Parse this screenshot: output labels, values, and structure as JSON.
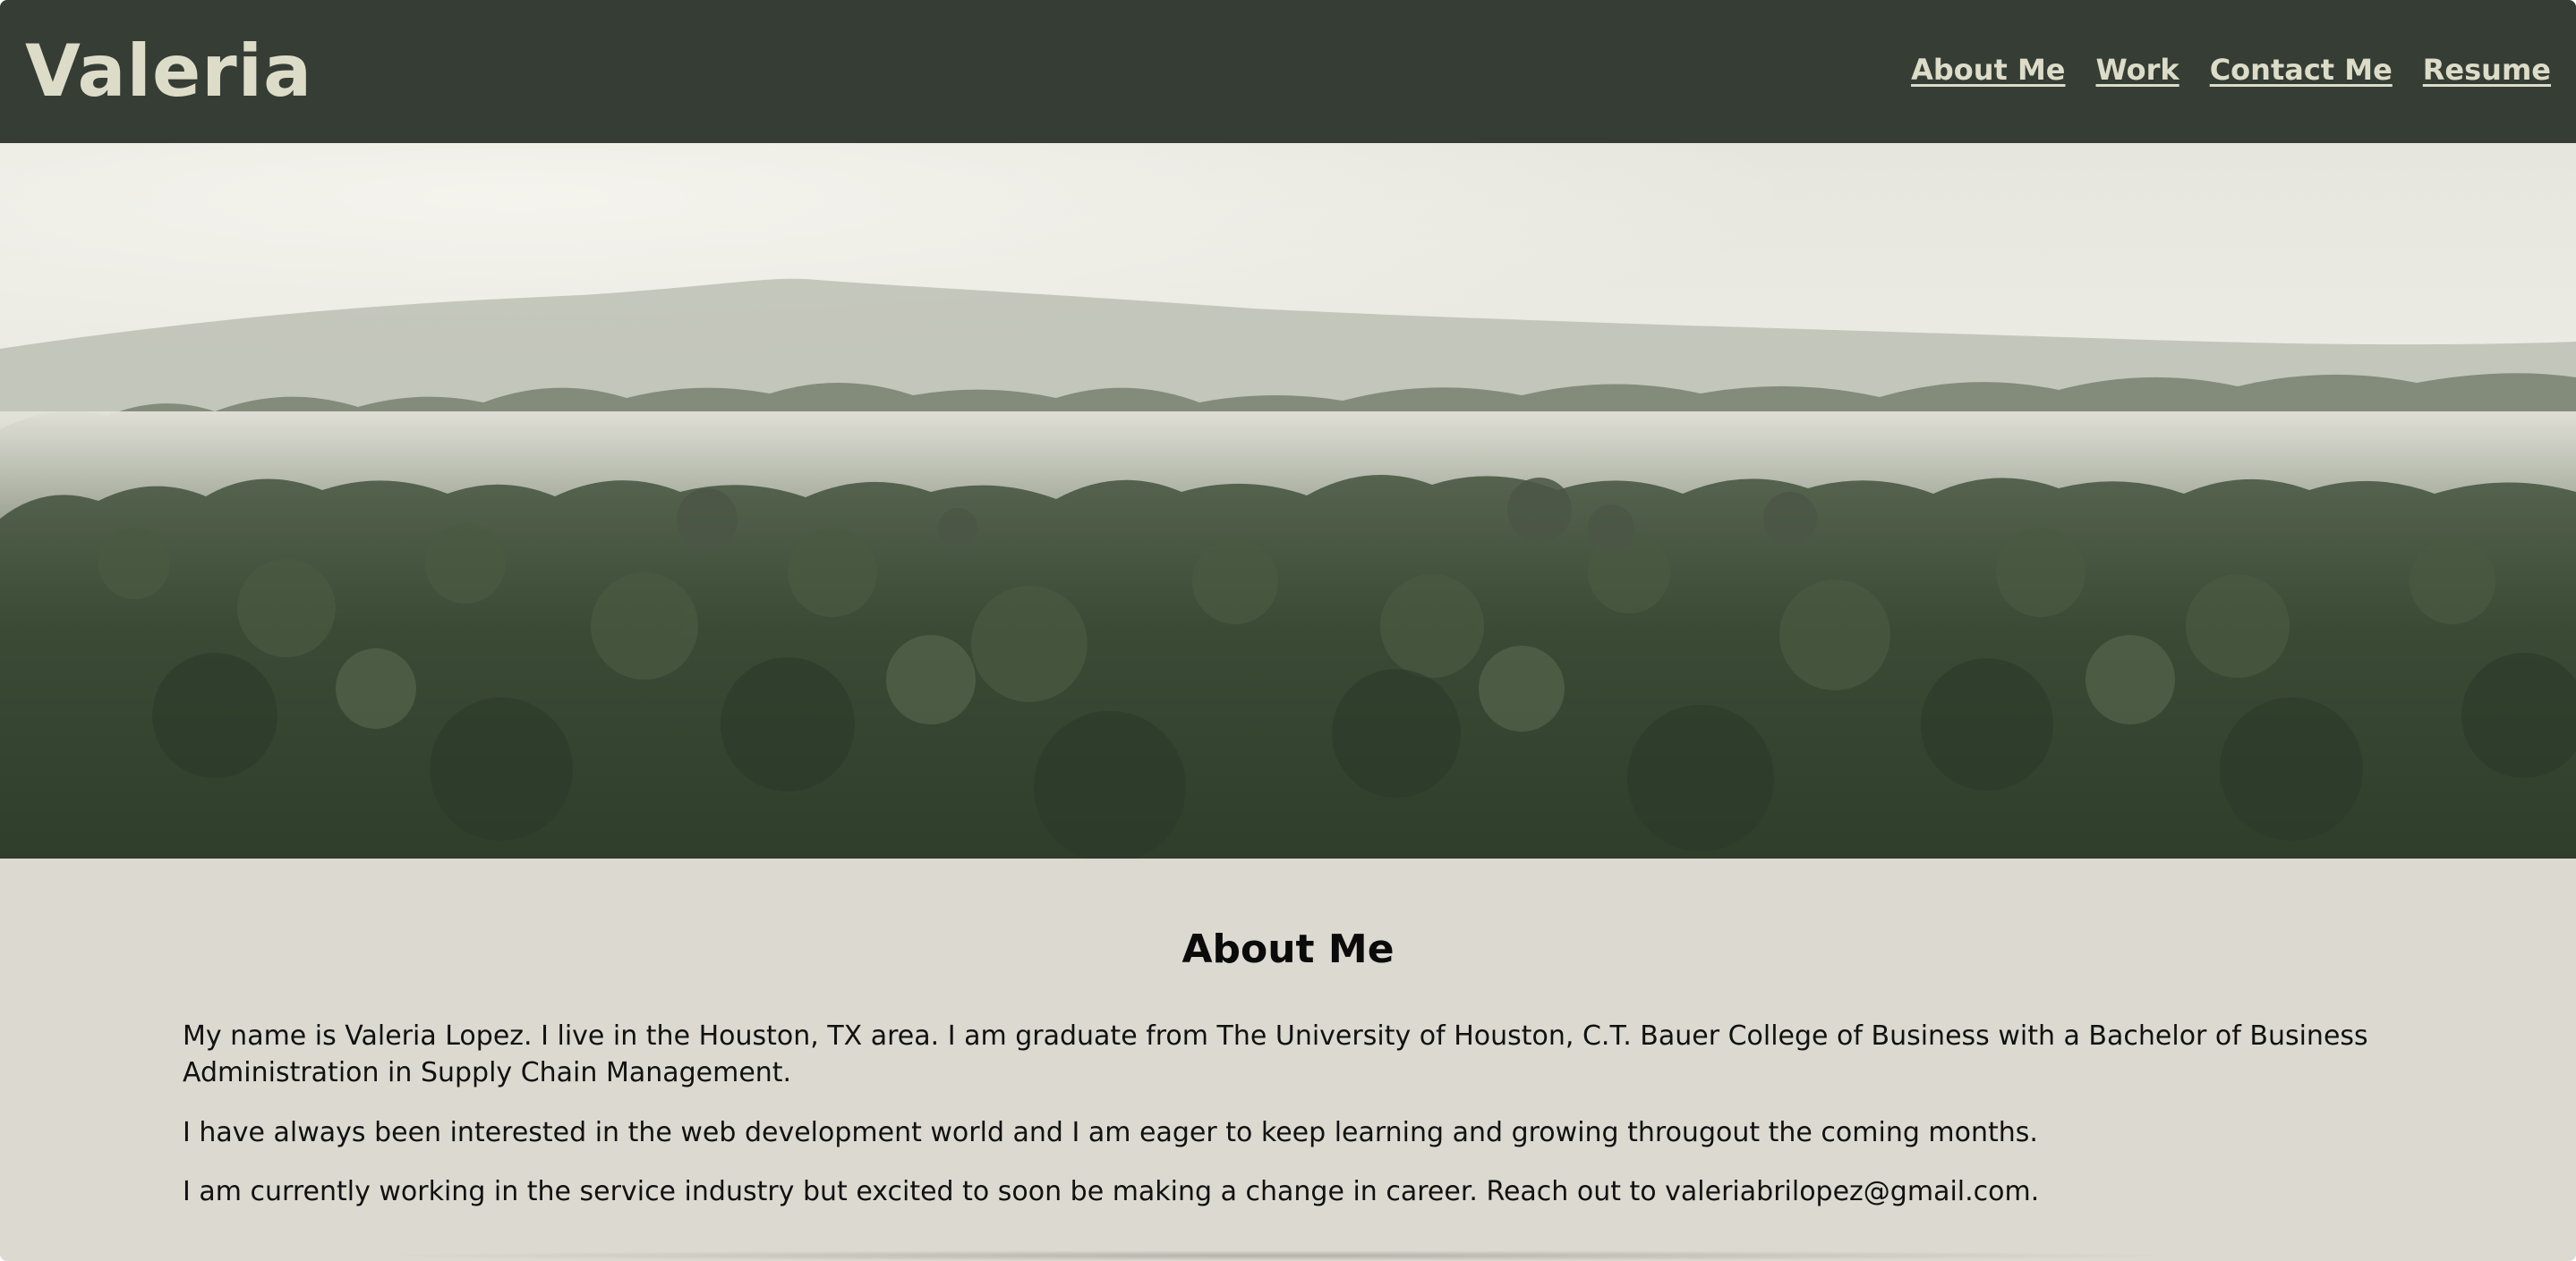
{
  "header": {
    "brand": "Valeria",
    "nav": [
      {
        "label": "About Me"
      },
      {
        "label": "Work"
      },
      {
        "label": "Contact Me"
      },
      {
        "label": "Resume"
      }
    ]
  },
  "hero": {
    "description_icon": "forest-landscape-image"
  },
  "about": {
    "title": "About Me",
    "paragraphs": [
      "My name is Valeria Lopez. I live in the Houston, TX area. I am graduate from The University of Houston, C.T. Bauer College of Business with a Bachelor of Business Administration in Supply Chain Management.",
      "I have always been interested in the web development world and I am eager to keep learning and growing througout the coming months.",
      "I am currently working in the service industry but excited to soon be making a change in career. Reach out to valeriabrilopez@gmail.com."
    ]
  },
  "colors": {
    "header_bg": "#353d35",
    "header_text": "#dcdcc8",
    "section_bg": "#dcdad0"
  }
}
